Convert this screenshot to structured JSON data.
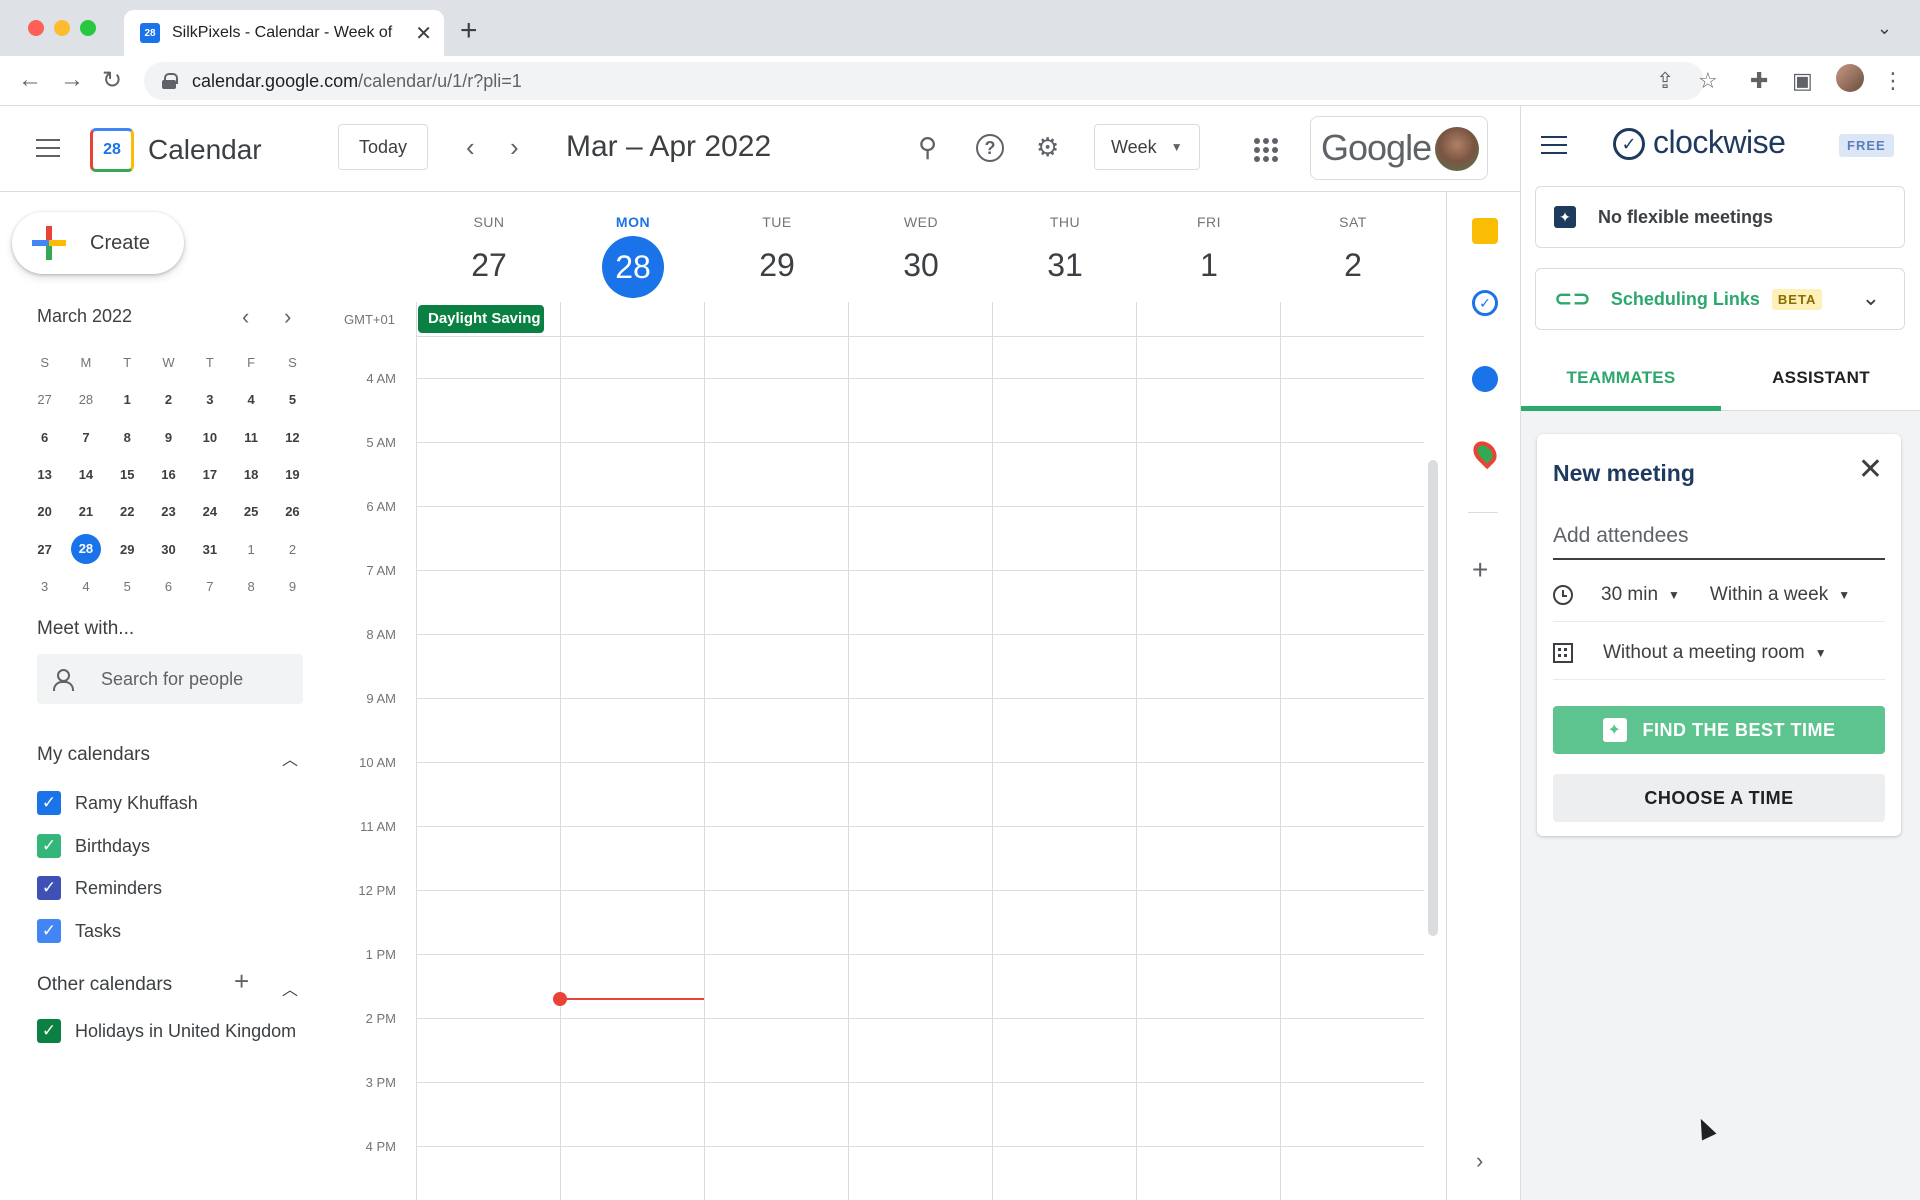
{
  "browser": {
    "tab_title": "SilkPixels - Calendar - Week of",
    "tab_favicon": "28",
    "url_host": "calendar.google.com",
    "url_path": "/calendar/u/1/r?pli=1"
  },
  "header": {
    "app_title": "Calendar",
    "logo_day": "28",
    "today_label": "Today",
    "date_range": "Mar – Apr 2022",
    "view_label": "Week",
    "google_word": "Google"
  },
  "sidebar": {
    "create_label": "Create",
    "mini_calendar": {
      "title": "March 2022",
      "weekday_heads": [
        "S",
        "M",
        "T",
        "W",
        "T",
        "F",
        "S"
      ],
      "weeks": [
        [
          "27",
          "28",
          "1",
          "2",
          "3",
          "4",
          "5"
        ],
        [
          "6",
          "7",
          "8",
          "9",
          "10",
          "11",
          "12"
        ],
        [
          "13",
          "14",
          "15",
          "16",
          "17",
          "18",
          "19"
        ],
        [
          "20",
          "21",
          "22",
          "23",
          "24",
          "25",
          "26"
        ],
        [
          "27",
          "28",
          "29",
          "30",
          "31",
          "1",
          "2"
        ],
        [
          "3",
          "4",
          "5",
          "6",
          "7",
          "8",
          "9"
        ]
      ]
    },
    "meet_with": "Meet with...",
    "search_people_placeholder": "Search for people",
    "my_calendars_title": "My calendars",
    "my_calendars": [
      {
        "label": "Ramy Khuffash",
        "color": "#1a73e8"
      },
      {
        "label": "Birthdays",
        "color": "#33b679"
      },
      {
        "label": "Reminders",
        "color": "#3f51b5"
      },
      {
        "label": "Tasks",
        "color": "#4285f4"
      }
    ],
    "other_calendars_title": "Other calendars",
    "other_calendars": [
      {
        "label": "Holidays in United Kingdom",
        "color": "#0b8043"
      }
    ]
  },
  "week": {
    "days": [
      {
        "name": "SUN",
        "num": "27"
      },
      {
        "name": "MON",
        "num": "28"
      },
      {
        "name": "TUE",
        "num": "29"
      },
      {
        "name": "WED",
        "num": "30"
      },
      {
        "name": "THU",
        "num": "31"
      },
      {
        "name": "FRI",
        "num": "1"
      },
      {
        "name": "SAT",
        "num": "2"
      }
    ],
    "timezone": "GMT+01",
    "allday_event": "Daylight Saving",
    "hours": [
      "4 AM",
      "5 AM",
      "6 AM",
      "7 AM",
      "8 AM",
      "9 AM",
      "10 AM",
      "11 AM",
      "12 PM",
      "1 PM",
      "2 PM",
      "3 PM",
      "4 PM"
    ]
  },
  "clockwise": {
    "logo_text": "clockwise",
    "plan_badge": "FREE",
    "flexible_meetings": "No flexible meetings",
    "scheduling_links": "Scheduling Links",
    "beta_badge": "BETA",
    "tabs": [
      "TEAMMATES",
      "ASSISTANT"
    ],
    "new_meeting": {
      "title": "New meeting",
      "attendees_placeholder": "Add attendees",
      "duration": "30 min",
      "window": "Within a week",
      "room": "Without a meeting room",
      "find_best_time": "FIND THE BEST TIME",
      "choose_time": "CHOOSE A TIME"
    }
  }
}
